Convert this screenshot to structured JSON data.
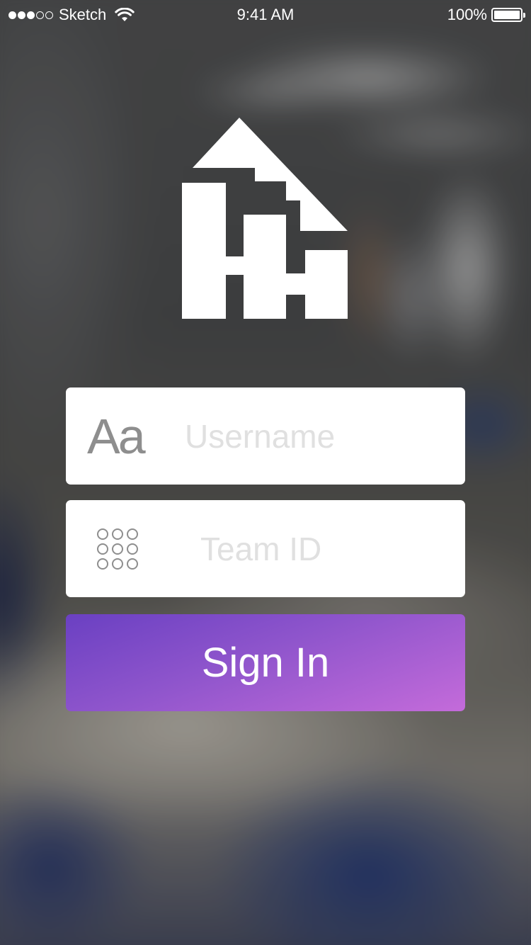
{
  "status_bar": {
    "carrier": "Sketch",
    "time": "9:41 AM",
    "battery": "100%",
    "signal_bars_filled": 3,
    "signal_bars_total": 5,
    "battery_level_percent": 100,
    "icons": [
      "signal-dots",
      "wifi-icon",
      "battery-icon"
    ]
  },
  "logo": {
    "icon": "building-arrow-logo",
    "color": "#ffffff"
  },
  "form": {
    "username": {
      "icon": "text-aa-icon",
      "icon_text": "Aa",
      "placeholder": "Username",
      "value": ""
    },
    "team_id": {
      "icon": "keypad-icon",
      "placeholder": "Team ID",
      "value": ""
    },
    "sign_in": {
      "label": "Sign In",
      "gradient_start": "#6a40c2",
      "gradient_end": "#c46bda"
    }
  }
}
